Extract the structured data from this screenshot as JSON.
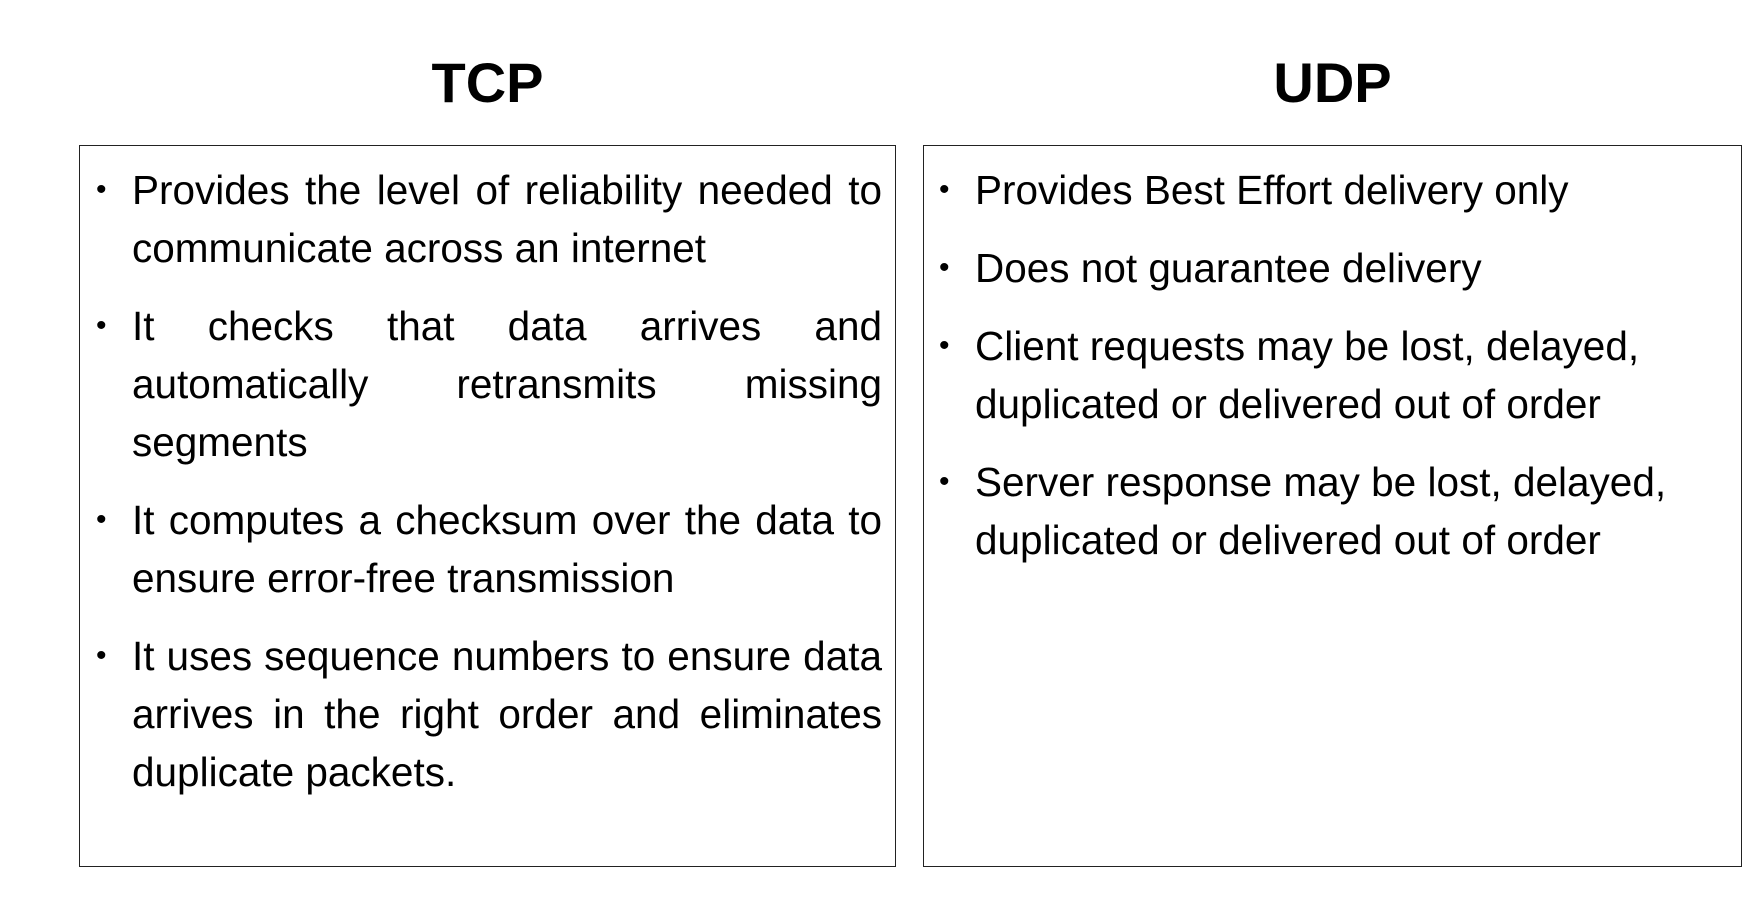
{
  "tcp": {
    "heading": "TCP",
    "items": [
      "Provides the level of reliability needed to communicate across an internet",
      "It checks that data arrives and automatically retransmits missing segments",
      "It computes a checksum over the data to ensure error-free transmission",
      "It uses sequence numbers to ensure data arrives in the right order and eliminates duplicate packets."
    ]
  },
  "udp": {
    "heading": "UDP",
    "items": [
      "Provides Best Effort delivery only",
      "Does not guarantee delivery",
      "Client requests may be lost, delayed, duplicated or delivered out of order",
      "Server response may be lost, delayed, duplicated or delivered out of order"
    ]
  },
  "bullet_symbol": "•"
}
